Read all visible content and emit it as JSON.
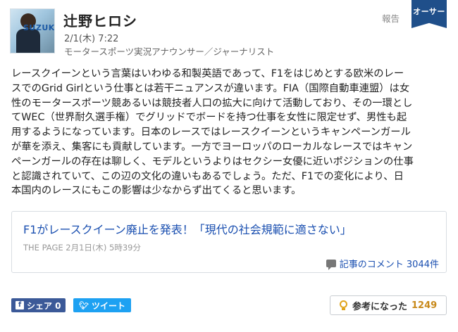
{
  "author": {
    "name": "辻野ヒロシ",
    "posted_at": "2/1(木) 7:22",
    "role": "モータースポーツ実況アナウンサー／ジャーナリスト",
    "avatar_sign_text": "SUZUKI"
  },
  "header": {
    "report_label": "報告",
    "ribbon_label": "オーサー"
  },
  "comment": {
    "text": "レースクイーンという言葉はいわゆる和製英語であって、F1をはじめとする欧米のレー\nスでのGrid Girlという仕事とは若干ニュアンスが違います。FIA（国際自動車連盟）は女\n性のモータースポーツ競あるいは競技者人口の拡大に向けて活動しており、その一環とし\nてWEC（世界耐久選手権）でグリッドでボードを持つ仕事を女性に限定せず、男性も起\n用するようになっています。日本のレースではレースクイーンというキャンペーンガール\nが華を添え、集客にも貢献しています。一方でヨーロッパのローカルなレースではキャン\nペーンガールの存在は聊しく、モデルというよりはセクシー女優に近いポジションの仕事\nと認識されていて、この辺の文化の違いもあるでしょう。ただ、F1での変化により、日\n本国内のレースにもこの影響は少なからず出てくると思います。"
  },
  "article": {
    "title": "F1がレースクイーン廃止を発表！「現代の社会規範に適さない」",
    "meta": "THE PAGE  2月1日(木) 5時39分",
    "comments_label": "記事のコメント 3044件"
  },
  "footer": {
    "facebook_icon": "f",
    "facebook_label": "シェア 0",
    "twitter_label": "ツイート",
    "helpful_label": "参考になった",
    "helpful_count": "1249"
  },
  "colors": {
    "link": "#1a4fb0",
    "ribbon": "#1f4f8a",
    "facebook": "#3b5998",
    "twitter": "#1da1f2",
    "helpful_count": "#c8891a"
  }
}
